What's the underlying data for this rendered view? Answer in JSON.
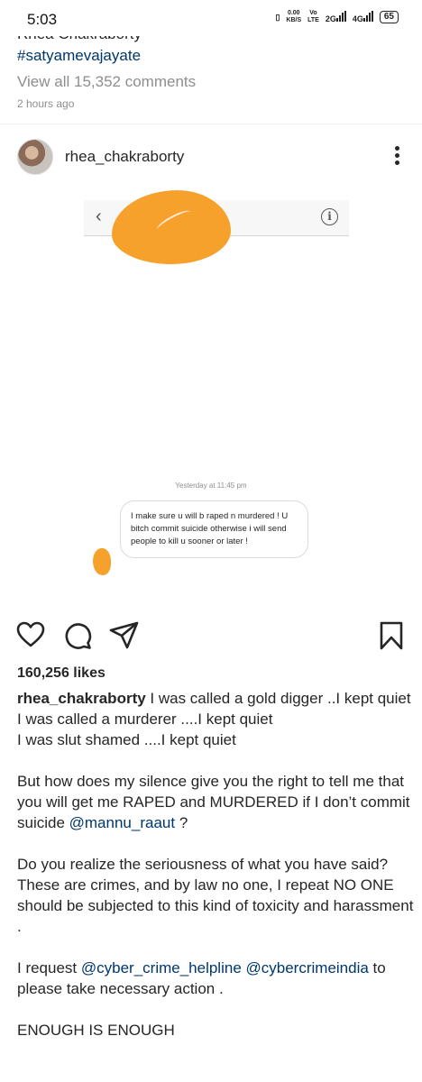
{
  "status_bar": {
    "time": "5:03",
    "speed_top": "0.00",
    "speed_bottom": "KB/S",
    "volte_top": "Vo",
    "volte_bottom": "LTE",
    "net1": "2G",
    "net2": "4G",
    "battery": "65"
  },
  "previous_post": {
    "author_line": "Rhea Chakraborty",
    "hashtag": "#satyamevajayate",
    "view_comments": "View all 15,352 comments",
    "time_ago": "2 hours ago"
  },
  "post": {
    "username": "rhea_chakraborty",
    "screenshot": {
      "timestamp": "Yesterday at 11:45 pm",
      "message": "I make sure u will b raped n murdered ! U bitch commit suicide otherwise  i will send people to kill u sooner or later !"
    },
    "likes": "160,256 likes",
    "caption": {
      "username": "rhea_chakraborty",
      "l1": " I was called a gold digger ..I kept quiet",
      "l2": "I was called  a murderer ....I kept quiet",
      "l3": "I was slut shamed ....I kept  quiet",
      "p2": "But how does my silence give you the right to tell me that you will get me RAPED and MURDERED if I don’t commit suicide ",
      "p2_mention": "@mannu_raaut",
      "p2_end": " ?",
      "p3": "Do you realize the seriousness of what you have said? These are crimes, and by law no one, I repeat NO ONE should be subjected to this kind of toxicity and harassment .",
      "p4_start": "I request ",
      "p4_mention1": "@cyber_crime_helpline",
      "p4_mention2": "@cybercrimeindia",
      "p4_end": " to please take necessary action .",
      "p5": "ENOUGH IS ENOUGH"
    }
  },
  "colors": {
    "text": "#262626",
    "link": "#00376b",
    "muted": "#8e8e8e",
    "redaction": "#f6a12b"
  }
}
